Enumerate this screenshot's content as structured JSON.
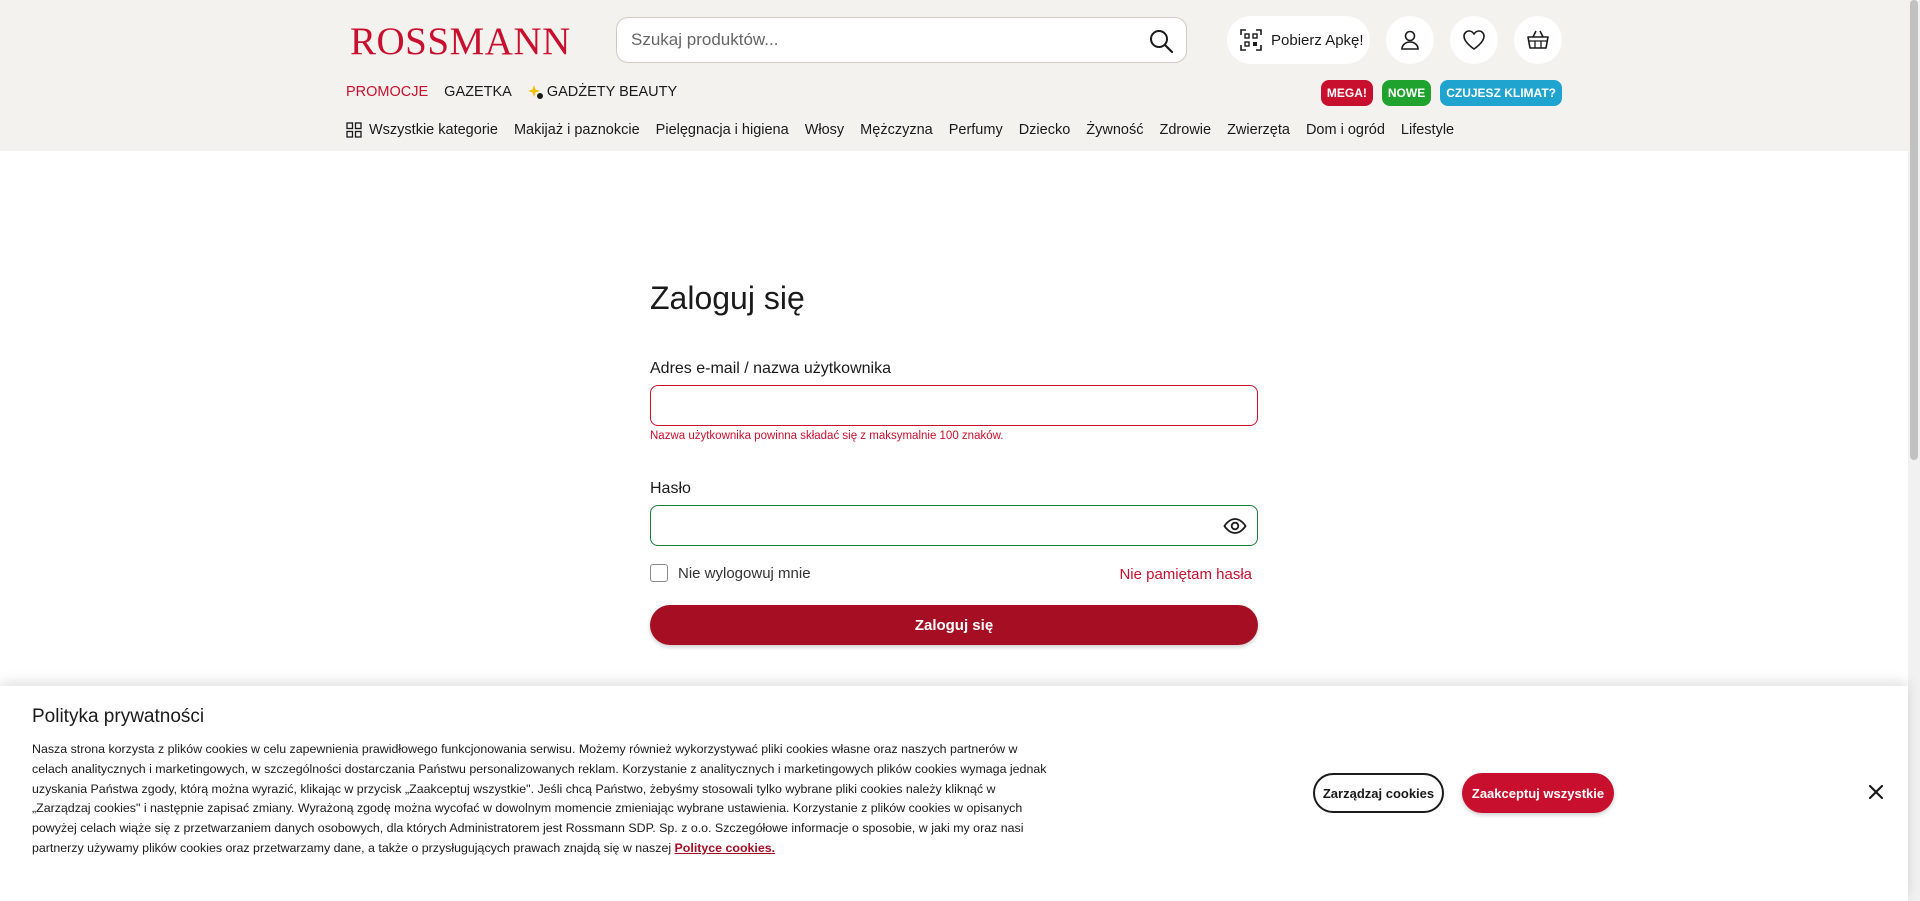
{
  "header": {
    "logo_text": "ROSSMANN",
    "search_placeholder": "Szukaj produktów...",
    "app_button": "Pobierz Apkę!",
    "topnav": [
      {
        "label": "PROMOCJE"
      },
      {
        "label": "GAZETKA"
      },
      {
        "label": "GADŻETY BEAUTY"
      }
    ],
    "badges": [
      "MEGA!",
      "NOWE",
      "CZUJESZ KLIMAT?"
    ],
    "categories": [
      "Wszystkie kategorie",
      "Makijaż i paznokcie",
      "Pielęgnacja i higiena",
      "Włosy",
      "Mężczyzna",
      "Perfumy",
      "Dziecko",
      "Żywność",
      "Zdrowie",
      "Zwierzęta",
      "Dom i ogród",
      "Lifestyle"
    ]
  },
  "login": {
    "title": "Zaloguj się",
    "email_label": "Adres e-mail / nazwa użytkownika",
    "email_value": "",
    "email_error": "Nazwa użytkownika powinna składać się z maksymalnie 100 znaków.",
    "password_label": "Hasło",
    "password_value": "",
    "remember_label": "Nie wylogowuj mnie",
    "forgot_link": "Nie pamiętam hasła",
    "submit_label": "Zaloguj się"
  },
  "cookie": {
    "title": "Polityka prywatności",
    "text": "Nasza strona korzysta z plików cookies w celu zapewnienia prawidłowego funkcjonowania serwisu. Możemy również wykorzystywać pliki cookies własne oraz naszych partnerów w celach analitycznych i marketingowych, w szczególności dostarczania Państwu personalizowanych reklam. Korzystanie z analitycznych i marketingowych plików cookies wymaga jednak uzyskania Państwa zgody, którą można wyrazić, klikając w przycisk „Zaakceptuj wszystkie\". Jeśli chcą Państwo, żebyśmy stosowali tylko wybrane pliki cookies należy kliknąć w „Zarządzaj cookies\" i następnie zapisać zmiany. Wyrażoną zgodę można wycofać w dowolnym momencie zmieniając wybrane ustawienia. Korzystanie z plików cookies w opisanych powyżej celach wiąże się z przetwarzaniem danych osobowych, dla których Administratorem jest Rossmann SDP. Sp. z o.o. Szczegółowe informacje o sposobie, w jaki my oraz nasi partnerzy używamy plików cookies oraz przetwarzamy dane, a także o przysługujących prawach znajdą się w naszej ",
    "link": "Polityce cookies.",
    "manage_button": "Zarządzaj cookies",
    "accept_button": "Zaakceptuj wszystkie"
  },
  "colors": {
    "brand_red": "#c8102e",
    "button_dark_red": "#a50e23",
    "header_bg": "#f4f2ee",
    "valid_green": "#1e7d3b",
    "badge_green": "#1fa22e",
    "badge_blue": "#1fa3cf"
  }
}
